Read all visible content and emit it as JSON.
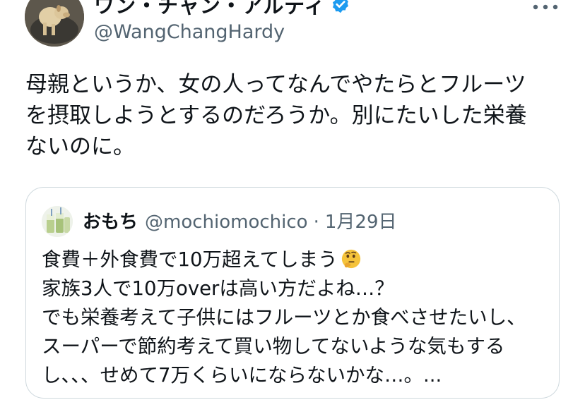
{
  "author": {
    "display_name": "ワン・チャン・アルディ",
    "handle": "@WangChangHardy",
    "verified": true,
    "avatar_icon": "dog-avatar"
  },
  "tweet": {
    "lines": [
      "母親というか、女の人ってなんでやたらとフルーツ",
      "を摂取しようとするのだろうか。別にたいした栄養",
      "ないのに。"
    ]
  },
  "quote": {
    "display_name": "おもち",
    "handle": "@mochiomochico",
    "separator": "·",
    "date": "1月29日",
    "lines": [
      "食費＋外食費で10万超えてしまう",
      "家族3人で10万overは高い方だよね…？",
      "でも栄養考えて子供にはフルーツとか食べさせたいし、",
      "スーパーで節約考えて買い物してないような気もする",
      "し、、、せめて7万くらいにならないかな…。..."
    ],
    "emoji": "thinking-face-icon"
  },
  "colors": {
    "text": "#0f1419",
    "secondary": "#536471",
    "verified_blue": "#1d9bf0",
    "border": "#cfd9de"
  }
}
